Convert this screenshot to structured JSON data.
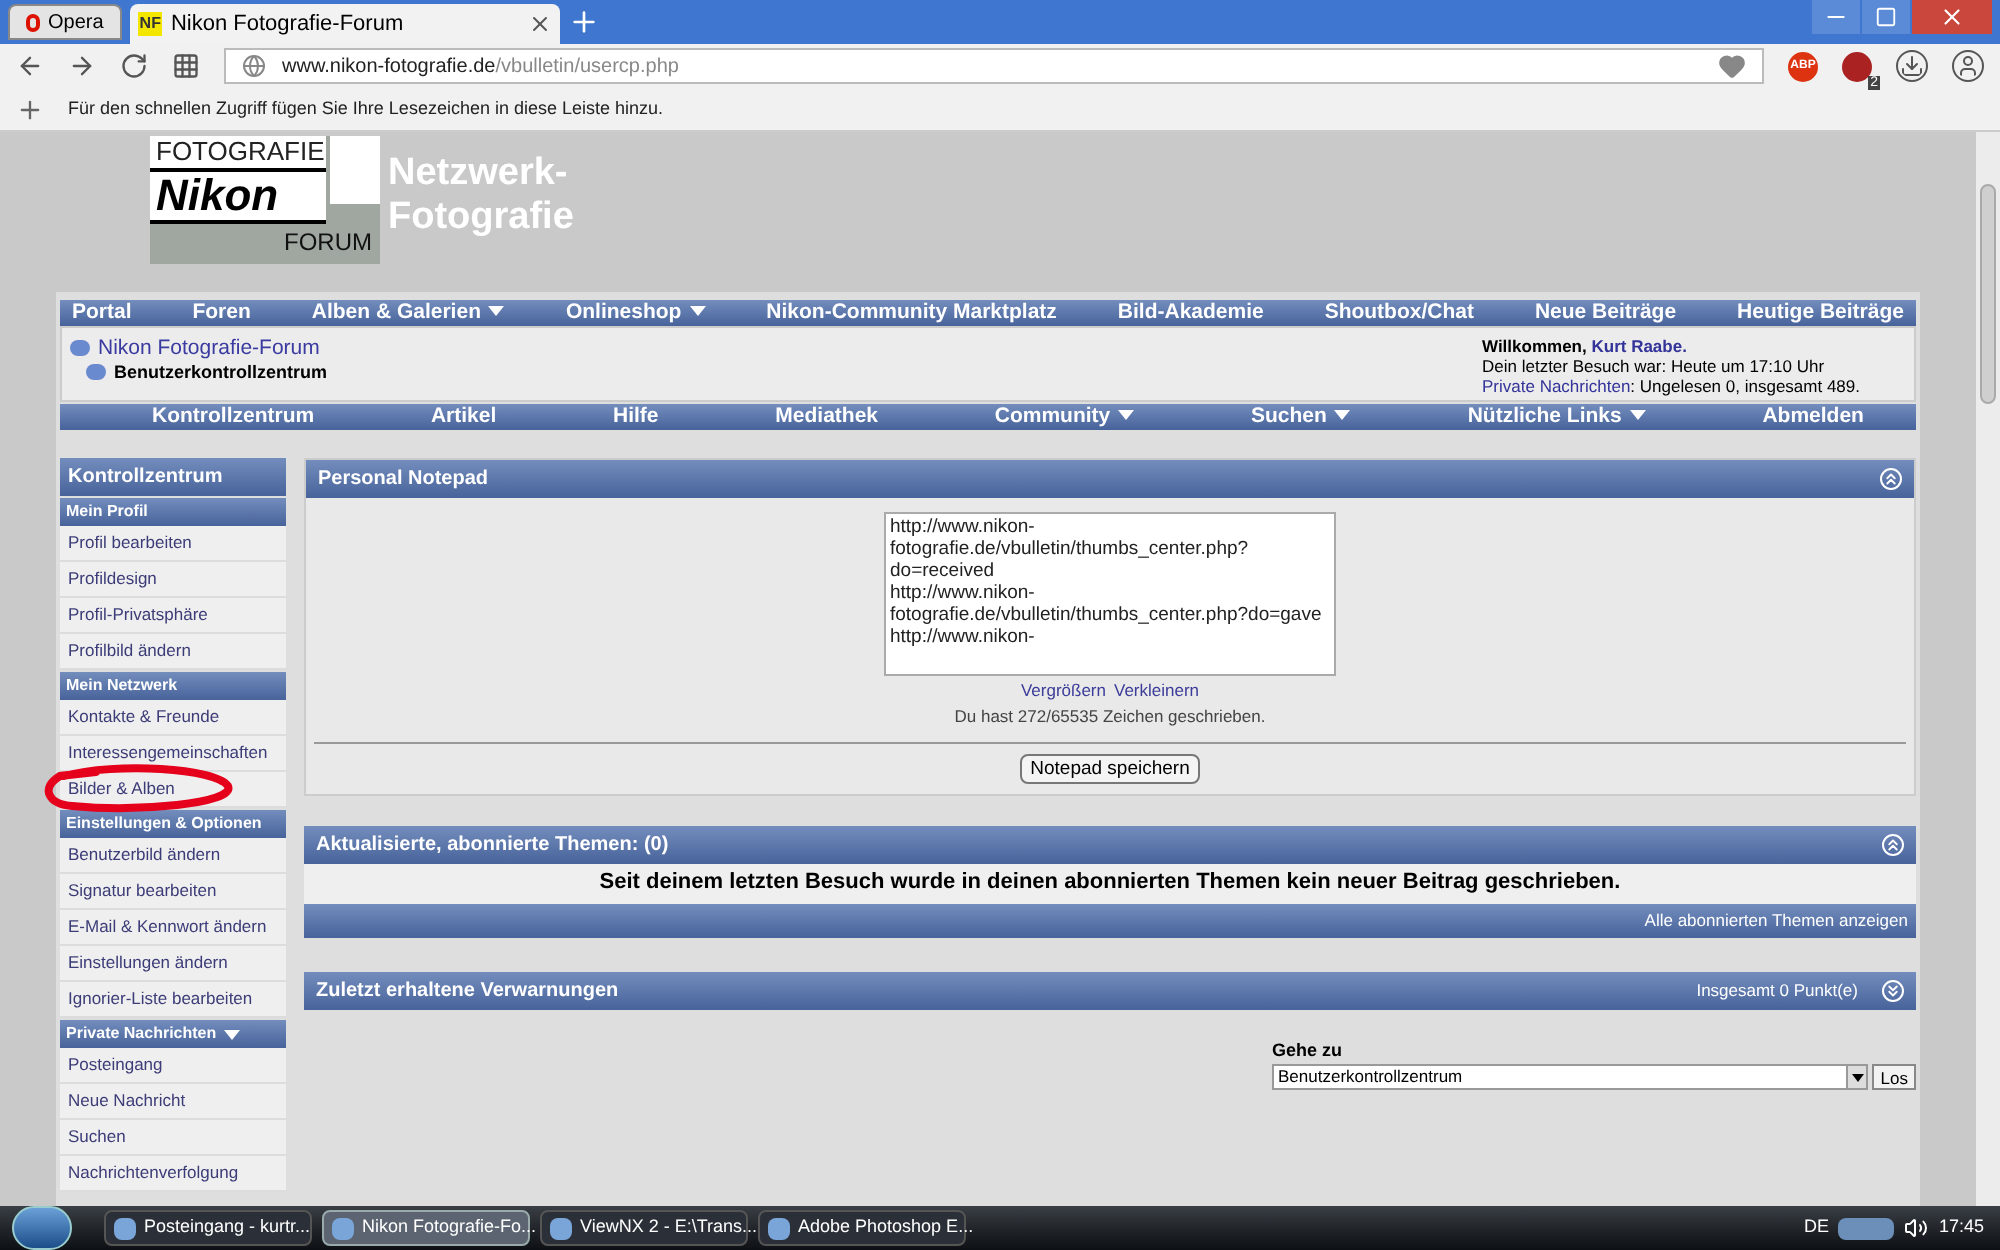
{
  "browser": {
    "menu_button": "Opera",
    "tabs": [
      {
        "label": "Nikon Fotografie-Forum",
        "favicon": "NF",
        "selected": true
      }
    ],
    "url_host": "www.nikon-fotografie.de",
    "url_path": "/vbulletin/usercp.php",
    "bookmarks_hint": "Für den schnellen Zugriff fügen Sie Ihre Lesezeichen in diese Leiste hinzu.",
    "extension_badge": "2",
    "adblock_label": "ABP"
  },
  "site": {
    "logo": [
      "FOTOGRAFIE",
      "Nikon",
      "FORUM"
    ],
    "slogan": [
      "Netzwerk-",
      "Fotografie"
    ]
  },
  "top_nav": [
    {
      "label": "Portal",
      "dropdown": false
    },
    {
      "label": "Foren",
      "dropdown": false
    },
    {
      "label": "Alben & Galerien",
      "dropdown": true
    },
    {
      "label": "Onlineshop",
      "dropdown": true
    },
    {
      "label": "Nikon-Community Marktplatz",
      "dropdown": false
    },
    {
      "label": "Bild-Akademie",
      "dropdown": false
    },
    {
      "label": "Shoutbox/Chat",
      "dropdown": false
    },
    {
      "label": "Neue Beiträge",
      "dropdown": false
    },
    {
      "label": "Heutige Beiträge",
      "dropdown": false
    }
  ],
  "breadcrumb": {
    "forum": "Nikon Fotografie-Forum",
    "current": "Benutzerkontrollzentrum"
  },
  "welcome": {
    "greeting": "Willkommen,",
    "user": "Kurt Raabe.",
    "last_visit": "Dein letzter Besuch war: Heute um 17:10 Uhr",
    "pm_link": "Private Nachrichten",
    "pm_text": ": Ungelesen 0, insgesamt 489."
  },
  "sub_nav": [
    {
      "label": "Kontrollzentrum",
      "dropdown": false
    },
    {
      "label": "Artikel",
      "dropdown": false
    },
    {
      "label": "Hilfe",
      "dropdown": false
    },
    {
      "label": "Mediathek",
      "dropdown": false
    },
    {
      "label": "Community",
      "dropdown": true
    },
    {
      "label": "Suchen",
      "dropdown": true
    },
    {
      "label": "Nützliche Links",
      "dropdown": true
    },
    {
      "label": "Abmelden",
      "dropdown": false
    }
  ],
  "sidebar": {
    "title": "Kontrollzentrum",
    "sections": [
      {
        "heading": "Mein Profil",
        "dropdown": false,
        "items": [
          {
            "label": "Profil bearbeiten",
            "marked": false
          },
          {
            "label": "Profildesign",
            "marked": false
          },
          {
            "label": "Profil-Privatsphäre",
            "marked": false
          },
          {
            "label": "Profilbild ändern",
            "marked": false
          }
        ]
      },
      {
        "heading": "Mein Netzwerk",
        "dropdown": false,
        "items": [
          {
            "label": "Kontakte & Freunde",
            "marked": false
          },
          {
            "label": "Interessengemeinschaften",
            "marked": false
          },
          {
            "label": "Bilder & Alben",
            "marked": true
          }
        ]
      },
      {
        "heading": "Einstellungen & Optionen",
        "dropdown": false,
        "items": [
          {
            "label": "Benutzerbild ändern",
            "marked": false
          },
          {
            "label": "Signatur bearbeiten",
            "marked": false
          },
          {
            "label": "E-Mail & Kennwort ändern",
            "marked": false
          },
          {
            "label": "Einstellungen ändern",
            "marked": false
          },
          {
            "label": "Ignorier-Liste bearbeiten",
            "marked": false
          }
        ]
      },
      {
        "heading": "Private Nachrichten",
        "dropdown": true,
        "items": [
          {
            "label": "Posteingang",
            "marked": false
          },
          {
            "label": "Neue Nachricht",
            "marked": false
          },
          {
            "label": "Suchen",
            "marked": false
          },
          {
            "label": "Nachrichtenverfolgung",
            "marked": false
          }
        ]
      }
    ]
  },
  "notepad": {
    "title": "Personal Notepad",
    "text": "http://www.nikon-fotografie.de/vbulletin/thumbs_center.php?do=received\nhttp://www.nikon-fotografie.de/vbulletin/thumbs_center.php?do=gave\nhttp://www.nikon-",
    "links": [
      "Vergrößern",
      "Verkleinern"
    ],
    "counter": "Du hast 272/65535 Zeichen geschrieben.",
    "save_button": "Notepad speichern"
  },
  "subscribed": {
    "title": "Aktualisierte, abonnierte Themen:",
    "count": "(0)",
    "message": "Seit deinem letzten Besuch wurde in deinen abonnierten Themen kein neuer Beitrag geschrieben.",
    "footer_link": "Alle abonnierten Themen anzeigen"
  },
  "warnings": {
    "title": "Zuletzt erhaltene Verwarnungen",
    "total": "Insgesamt 0 Punkt(e)"
  },
  "jump": {
    "label": "Gehe zu",
    "value": "Benutzerkontrollzentrum",
    "button": "Los"
  },
  "taskbar": {
    "items": [
      {
        "label": "Posteingang - kurtr...",
        "selected": false
      },
      {
        "label": "Nikon Fotografie-Fo...",
        "selected": true
      },
      {
        "label": "ViewNX 2 - E:\\Trans...",
        "selected": false
      },
      {
        "label": "Adobe Photoshop E...",
        "selected": false
      }
    ],
    "language": "DE",
    "time": "17:45"
  }
}
